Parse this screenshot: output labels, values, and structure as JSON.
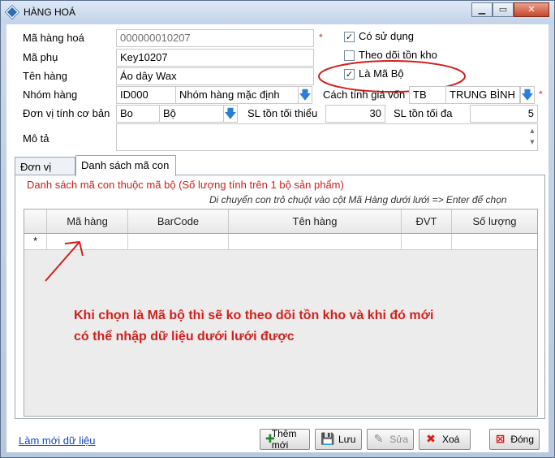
{
  "window": {
    "title": "HÀNG HOÁ"
  },
  "form": {
    "ma_hang_hoa": {
      "label": "Mã hàng hoá",
      "value": "000000010207"
    },
    "ma_phu": {
      "label": "Mã phụ",
      "value": "Key10207"
    },
    "ten_hang": {
      "label": "Tên hàng",
      "value": "Áo dây Wax"
    },
    "nhom_hang": {
      "label": "Nhóm hàng",
      "code": "ID000",
      "name": "Nhóm hàng mặc định"
    },
    "cach_tinh_gia_von": {
      "label": "Cách tính giá vốn",
      "code": "TB",
      "name": "TRUNG BÌNH"
    },
    "don_vi_tinh": {
      "label": "Đơn vị tính cơ bản",
      "code": "Bo",
      "name": "Bộ"
    },
    "sl_ton_toi_thieu": {
      "label": "SL tồn tối thiểu",
      "value": "30"
    },
    "sl_ton_toi_da": {
      "label": "SL tồn tối đa",
      "value": "5"
    },
    "mo_ta": {
      "label": "Mô tả",
      "value": ""
    },
    "required_mark": "*"
  },
  "checkboxes": {
    "co_su_dung": {
      "label": "Có sử dụng",
      "checked": true,
      "mark": "✓"
    },
    "theo_doi_ton_kho": {
      "label": "Theo dõi tồn kho",
      "checked": false,
      "mark": ""
    },
    "la_ma_bo": {
      "label": "Là Mã Bộ",
      "checked": true,
      "mark": "✓"
    }
  },
  "tabs": [
    {
      "label": "Đơn vị tính"
    },
    {
      "label": "Danh sách mã con"
    }
  ],
  "subpanel": {
    "title": "Danh sách mã con thuộc mã bộ (Số lượng tính trên 1 bộ sản phẩm)",
    "hint": "Di chuyển con trỏ chuột vào cột Mã Hàng dưới lưới => Enter để chọn"
  },
  "grid": {
    "columns": [
      "Mã hàng",
      "BarCode",
      "Tên hàng",
      "ĐVT",
      "Số lượng"
    ],
    "new_row_marker": "*"
  },
  "annotation": {
    "line1": "Khi chọn là Mã bộ thì sẽ ko theo dõi tồn kho và khi đó mới",
    "line2": "có thể nhập dữ liệu dưới lưới được",
    "color": "#d2201c"
  },
  "footer": {
    "refresh_link": "Làm mới dữ liệu",
    "buttons": {
      "them_moi": "Thêm mới",
      "luu": "Lưu",
      "sua": "Sửa",
      "xoa": "Xoá",
      "dong": "Đóng"
    }
  },
  "icons": {
    "dropdown": "down-arrow-icon"
  }
}
